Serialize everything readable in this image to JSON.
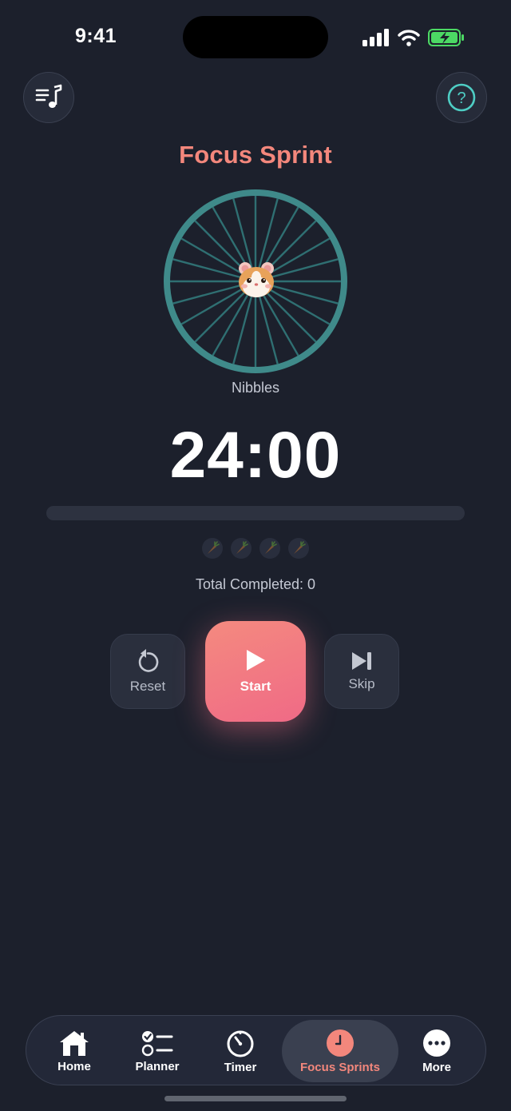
{
  "status_bar": {
    "time": "9:41"
  },
  "header": {
    "left_icon": "music-queue-icon",
    "right_icon": "help-icon",
    "title": "Focus Sprint"
  },
  "pet": {
    "name": "Nibbles",
    "icon": "hamster-icon"
  },
  "timer": {
    "value": "24:00",
    "progress": 0
  },
  "sessions": {
    "icon": "carrot-icon",
    "count": 4,
    "completed": 0
  },
  "stats": {
    "total_completed": "Total Completed: 0"
  },
  "controls": {
    "reset_label": "Reset",
    "start_label": "Start",
    "skip_label": "Skip"
  },
  "tabs": [
    {
      "label": "Home",
      "icon": "home-icon"
    },
    {
      "label": "Planner",
      "icon": "checklist-icon"
    },
    {
      "label": "Timer",
      "icon": "stopwatch-icon"
    },
    {
      "label": "Focus Sprints",
      "icon": "clock-icon",
      "active": true
    },
    {
      "label": "More",
      "icon": "more-icon"
    }
  ],
  "colors": {
    "background": "#1c202c",
    "accent": "#f3877c",
    "wheel": "#3f8a8a",
    "help_ring": "#4ecdc4"
  }
}
